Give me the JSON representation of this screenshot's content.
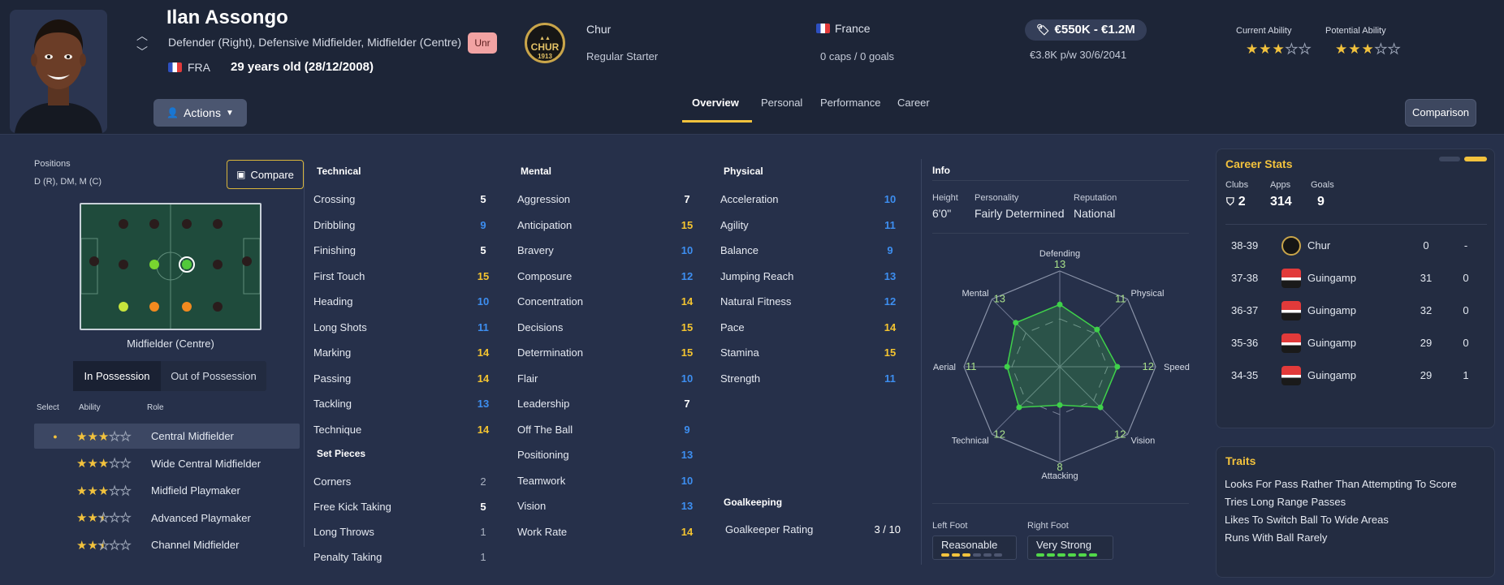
{
  "player": {
    "name": "Ilan Assongo",
    "positions": "Defender (Right), Defensive Midfielder, Midfielder (Centre)",
    "nationality_code": "FRA",
    "age": "29 years old (28/12/2008)",
    "status_tag": "Unr",
    "club": "Chur",
    "club_badge_text": "CHUR",
    "club_badge_year": "1913",
    "squad_status": "Regular Starter",
    "country": "France",
    "caps": "0 caps / 0 goals",
    "value": "€550K - €1.2M",
    "wage_contract": "€3.8K p/w 30/6/2041",
    "current_ability_label": "Current Ability",
    "current_ability_stars": 3,
    "potential_ability_label": "Potential Ability",
    "potential_ability_stars": 3
  },
  "toolbar": {
    "actions_label": "Actions",
    "tabs": [
      "Overview",
      "Personal",
      "Performance",
      "Career"
    ],
    "active_tab": "Overview",
    "comparison_label": "Comparison"
  },
  "positions_panel": {
    "label": "Positions",
    "value": "D (R), DM, M (C)",
    "compare_label": "Compare",
    "pitch_caption": "Midfielder (Centre)",
    "toggle": [
      "In Possession",
      "Out of Possession"
    ],
    "headers": {
      "select": "Select",
      "ability": "Ability",
      "role": "Role"
    },
    "roles": [
      {
        "name": "Central Midfielder",
        "stars": 3,
        "selected": true
      },
      {
        "name": "Wide Central Midfielder",
        "stars": 3,
        "selected": false
      },
      {
        "name": "Midfield Playmaker",
        "stars": 3,
        "selected": false
      },
      {
        "name": "Advanced Playmaker",
        "stars": 2.5,
        "selected": false
      },
      {
        "name": "Channel Midfielder",
        "stars": 2.5,
        "selected": false
      }
    ]
  },
  "attributes": {
    "technical_title": "Technical",
    "technical": [
      {
        "name": "Crossing",
        "value": "5",
        "color": "white"
      },
      {
        "name": "Dribbling",
        "value": "9",
        "color": "blue"
      },
      {
        "name": "Finishing",
        "value": "5",
        "color": "white"
      },
      {
        "name": "First Touch",
        "value": "15",
        "color": "yellow"
      },
      {
        "name": "Heading",
        "value": "10",
        "color": "blue"
      },
      {
        "name": "Long Shots",
        "value": "11",
        "color": "blue"
      },
      {
        "name": "Marking",
        "value": "14",
        "color": "yellow"
      },
      {
        "name": "Passing",
        "value": "14",
        "color": "yellow"
      },
      {
        "name": "Tackling",
        "value": "13",
        "color": "blue"
      },
      {
        "name": "Technique",
        "value": "14",
        "color": "yellow"
      }
    ],
    "set_pieces_title": "Set Pieces",
    "set_pieces": [
      {
        "name": "Corners",
        "value": "2",
        "color": "grey"
      },
      {
        "name": "Free Kick Taking",
        "value": "5",
        "color": "white"
      },
      {
        "name": "Long Throws",
        "value": "1",
        "color": "grey"
      },
      {
        "name": "Penalty Taking",
        "value": "1",
        "color": "grey"
      }
    ],
    "mental_title": "Mental",
    "mental": [
      {
        "name": "Aggression",
        "value": "7",
        "color": "white"
      },
      {
        "name": "Anticipation",
        "value": "15",
        "color": "yellow"
      },
      {
        "name": "Bravery",
        "value": "10",
        "color": "blue"
      },
      {
        "name": "Composure",
        "value": "12",
        "color": "blue"
      },
      {
        "name": "Concentration",
        "value": "14",
        "color": "yellow"
      },
      {
        "name": "Decisions",
        "value": "15",
        "color": "yellow"
      },
      {
        "name": "Determination",
        "value": "15",
        "color": "yellow"
      },
      {
        "name": "Flair",
        "value": "10",
        "color": "blue"
      },
      {
        "name": "Leadership",
        "value": "7",
        "color": "white"
      },
      {
        "name": "Off The Ball",
        "value": "9",
        "color": "blue"
      },
      {
        "name": "Positioning",
        "value": "13",
        "color": "blue"
      },
      {
        "name": "Teamwork",
        "value": "10",
        "color": "blue"
      },
      {
        "name": "Vision",
        "value": "13",
        "color": "blue"
      },
      {
        "name": "Work Rate",
        "value": "14",
        "color": "yellow"
      }
    ],
    "physical_title": "Physical",
    "physical": [
      {
        "name": "Acceleration",
        "value": "10",
        "color": "blue"
      },
      {
        "name": "Agility",
        "value": "11",
        "color": "blue"
      },
      {
        "name": "Balance",
        "value": "9",
        "color": "blue"
      },
      {
        "name": "Jumping Reach",
        "value": "13",
        "color": "blue"
      },
      {
        "name": "Natural Fitness",
        "value": "12",
        "color": "blue"
      },
      {
        "name": "Pace",
        "value": "14",
        "color": "yellow"
      },
      {
        "name": "Stamina",
        "value": "15",
        "color": "yellow"
      },
      {
        "name": "Strength",
        "value": "11",
        "color": "blue"
      }
    ],
    "goalkeeping_title": "Goalkeeping",
    "goalkeeper_rating_label": "Goalkeeper Rating",
    "goalkeeper_rating": "3 / 10"
  },
  "info": {
    "title": "Info",
    "height_label": "Height",
    "height": "6'0\"",
    "personality_label": "Personality",
    "personality": "Fairly Determined",
    "reputation_label": "Reputation",
    "reputation": "National",
    "left_foot_label": "Left Foot",
    "left_foot": "Reasonable",
    "left_foot_level": 3,
    "right_foot_label": "Right Foot",
    "right_foot": "Very Strong",
    "right_foot_level": 6
  },
  "radar": {
    "axes": [
      "Defending",
      "Physical",
      "Speed",
      "Vision",
      "Attacking",
      "Technical",
      "Aerial",
      "Mental"
    ],
    "values": [
      "13",
      "11",
      "12",
      "12",
      "8",
      "12",
      "11",
      "13"
    ],
    "max": 20
  },
  "career_stats": {
    "title": "Career Stats",
    "clubs_label": "Clubs",
    "clubs": "2",
    "apps_label": "Apps",
    "apps": "314",
    "goals_label": "Goals",
    "goals": "9",
    "rows": [
      {
        "season": "38-39",
        "club": "Chur",
        "apps": "0",
        "goals": "-"
      },
      {
        "season": "37-38",
        "club": "Guingamp",
        "apps": "31",
        "goals": "0"
      },
      {
        "season": "36-37",
        "club": "Guingamp",
        "apps": "32",
        "goals": "0"
      },
      {
        "season": "35-36",
        "club": "Guingamp",
        "apps": "29",
        "goals": "0"
      },
      {
        "season": "34-35",
        "club": "Guingamp",
        "apps": "29",
        "goals": "1"
      }
    ]
  },
  "traits": {
    "title": "Traits",
    "items": [
      "Looks For Pass Rather Than Attempting To Score",
      "Tries Long Range Passes",
      "Likes To Switch Ball To Wide Areas",
      "Runs With Ball Rarely"
    ]
  },
  "colors": {
    "accent": "#f2c23d",
    "blue_attr": "#3d8ef0",
    "yellow_attr": "#f4c430",
    "radar_green": "#3fd14a"
  }
}
